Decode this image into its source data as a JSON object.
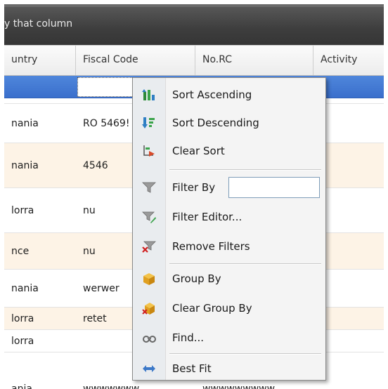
{
  "group_panel": {
    "hint": "y that column"
  },
  "columns": [
    {
      "label": "untry"
    },
    {
      "label": "Fiscal Code"
    },
    {
      "label": "No.RC"
    },
    {
      "label": "Activity"
    }
  ],
  "rows": [
    {
      "country": "",
      "fiscal": "",
      "norc": "",
      "activity": ""
    },
    {
      "country": "nania",
      "fiscal": "RO 5469!",
      "norc": "",
      "activity": ""
    },
    {
      "country": "nania",
      "fiscal": "4546",
      "norc": "",
      "activity": ""
    },
    {
      "country": "lorra",
      "fiscal": "nu",
      "norc": "",
      "activity": ""
    },
    {
      "country": "nce",
      "fiscal": "nu",
      "norc": "",
      "activity": ""
    },
    {
      "country": "nania",
      "fiscal": "werwer",
      "norc": "",
      "activity": ""
    },
    {
      "country": "lorra",
      "fiscal": "retet",
      "norc": "",
      "activity": ""
    },
    {
      "country": "lorra",
      "fiscal": "",
      "norc": "",
      "activity": ""
    },
    {
      "country": "ania",
      "fiscal": "wwwwwww",
      "norc": "wwwwwwwww",
      "activity": ""
    }
  ],
  "menu": {
    "sort_asc": "Sort Ascending",
    "sort_desc": "Sort Descending",
    "clear_sort": "Clear Sort",
    "filter_by": "Filter By",
    "filter_by_value": "",
    "filter_editor": "Filter Editor...",
    "remove_filters": "Remove Filters",
    "group_by": "Group By",
    "clear_group_by": "Clear Group By",
    "find": "Find...",
    "best_fit": "Best Fit"
  },
  "icons": {
    "sort_asc": "sort-ascending-icon",
    "sort_desc": "sort-descending-icon",
    "clear_sort": "clear-sort-icon",
    "filter_by": "funnel-icon",
    "filter_editor": "filter-editor-icon",
    "remove_filters": "remove-filter-icon",
    "group_by": "group-box-icon",
    "clear_group_by": "clear-group-icon",
    "find": "binoculars-icon",
    "best_fit": "double-arrow-icon"
  },
  "colors": {
    "selection": "#3f74cf",
    "alt_row": "#fdf3e6",
    "panel": "#434343"
  }
}
